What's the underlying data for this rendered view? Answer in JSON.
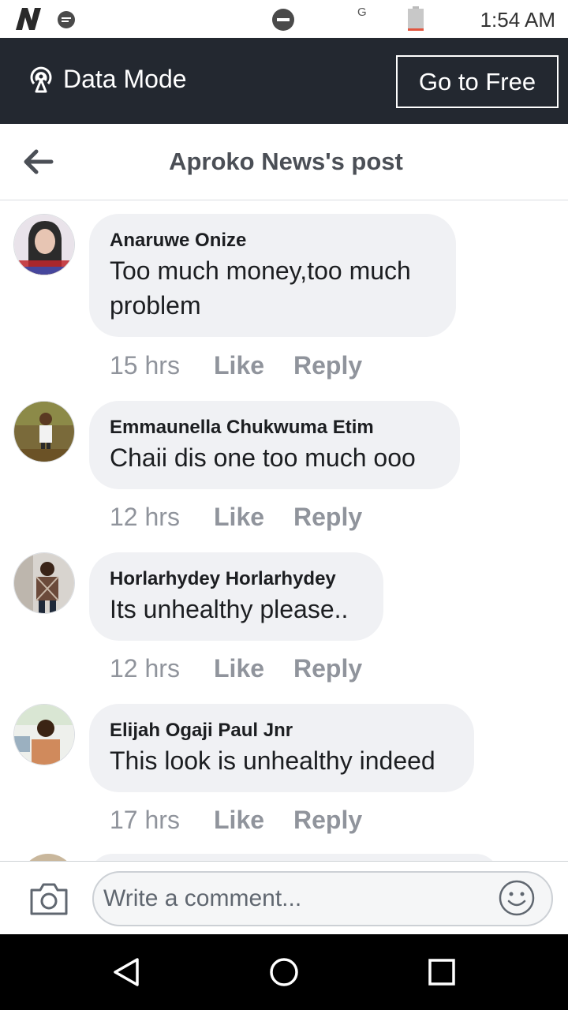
{
  "status_bar": {
    "network": "G",
    "time": "1:54 AM",
    "icons": [
      "n-app-icon",
      "message-icon",
      "do-not-disturb-icon",
      "battery-icon"
    ],
    "battery_color": "#e2553f"
  },
  "data_mode": {
    "label": "Data Mode",
    "icon": "broadcast-icon",
    "go_free_button": "Go to Free",
    "bg_color": "#232830"
  },
  "header": {
    "title": "Aproko News's post",
    "back_icon": "back-arrow-icon"
  },
  "comments": [
    {
      "author": "Anaruwe Onize",
      "text": "Too much money,too much problem",
      "time": "15 hrs",
      "like": "Like",
      "reply": "Reply"
    },
    {
      "author": "Emmaunella Chukwuma Etim",
      "text": "Chaii dis one  too much ooo",
      "time": "12 hrs",
      "like": "Like",
      "reply": "Reply"
    },
    {
      "author": "Horlarhydey Horlarhydey",
      "text": "Its unhealthy please..",
      "time": "12 hrs",
      "like": "Like",
      "reply": "Reply"
    },
    {
      "author": "Elijah Ogaji Paul Jnr",
      "text": "This look is unhealthy indeed",
      "time": "17 hrs",
      "like": "Like",
      "reply": "Reply"
    }
  ],
  "composer": {
    "placeholder": "Write a comment...",
    "camera_icon": "camera-icon",
    "emoji_icon": "emoji-icon"
  },
  "nav_bar": {
    "icons": [
      "nav-back-icon",
      "nav-home-icon",
      "nav-recents-icon"
    ]
  }
}
